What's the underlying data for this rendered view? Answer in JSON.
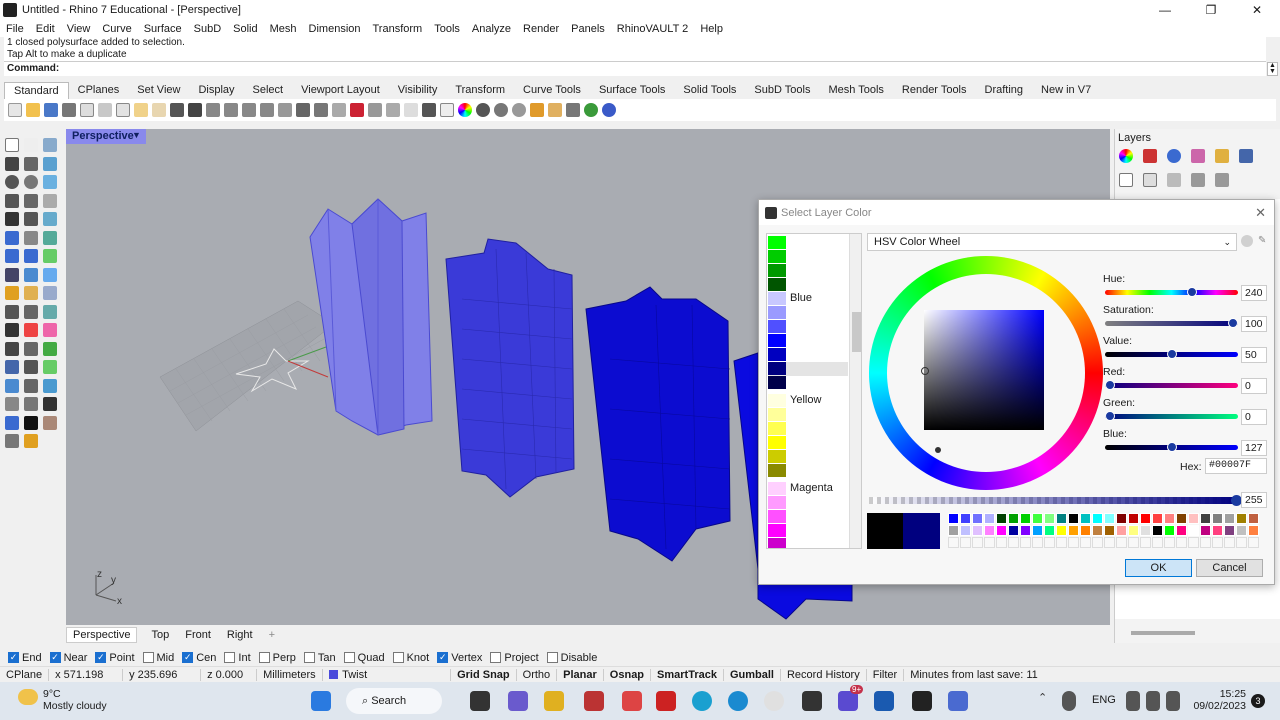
{
  "window": {
    "title": "Untitled - Rhino 7 Educational - [Perspective]",
    "controls": [
      "—",
      "❐",
      "✕"
    ]
  },
  "menu": [
    "File",
    "Edit",
    "View",
    "Curve",
    "Surface",
    "SubD",
    "Solid",
    "Mesh",
    "Dimension",
    "Transform",
    "Tools",
    "Analyze",
    "Render",
    "Panels",
    "RhinoVAULT 2",
    "Help"
  ],
  "command": {
    "history": [
      "1 closed polysurface added to selection.",
      "Tap Alt to make a duplicate"
    ],
    "prompt": "Command:"
  },
  "tabs": [
    "Standard",
    "CPlanes",
    "Set View",
    "Display",
    "Select",
    "Viewport Layout",
    "Visibility",
    "Transform",
    "Curve Tools",
    "Surface Tools",
    "Solid Tools",
    "SubD Tools",
    "Mesh Tools",
    "Render Tools",
    "Drafting",
    "New in V7"
  ],
  "viewport": {
    "title": "Perspective",
    "axes": {
      "x": "x",
      "y": "y",
      "z": "z"
    },
    "tabs": [
      "Perspective",
      "Top",
      "Front",
      "Right"
    ],
    "add_tab": "+"
  },
  "layers_panel": {
    "title": "Layers"
  },
  "dialog": {
    "title": "Select Layer Color",
    "close": "✕",
    "mode": "HSV Color Wheel",
    "swatch_labels": {
      "blue": "Blue",
      "yellow": "Yellow",
      "magenta": "Magenta"
    },
    "sliders": [
      {
        "label": "Hue:",
        "value": "240",
        "fraction": 0.67
      },
      {
        "label": "Saturation:",
        "value": "100",
        "fraction": 1.0
      },
      {
        "label": "Value:",
        "value": "50",
        "fraction": 0.5
      },
      {
        "label": "Red:",
        "value": "0",
        "fraction": 0.0
      },
      {
        "label": "Green:",
        "value": "0",
        "fraction": 0.0
      },
      {
        "label": "Blue:",
        "value": "127",
        "fraction": 0.5
      }
    ],
    "hex_label": "Hex:",
    "hex_value": "#00007F",
    "alpha_value": "255",
    "ok": "OK",
    "cancel": "Cancel",
    "colors": {
      "old": "#000000",
      "new": "#00007f"
    }
  },
  "osnaps": [
    {
      "label": "End",
      "checked": true
    },
    {
      "label": "Near",
      "checked": true
    },
    {
      "label": "Point",
      "checked": true
    },
    {
      "label": "Mid",
      "checked": false
    },
    {
      "label": "Cen",
      "checked": true
    },
    {
      "label": "Int",
      "checked": false
    },
    {
      "label": "Perp",
      "checked": false
    },
    {
      "label": "Tan",
      "checked": false
    },
    {
      "label": "Quad",
      "checked": false
    },
    {
      "label": "Knot",
      "checked": false
    },
    {
      "label": "Vertex",
      "checked": true
    },
    {
      "label": "Project",
      "checked": false
    },
    {
      "label": "Disable",
      "checked": false
    }
  ],
  "status": {
    "cplane": "CPlane",
    "x": "x 571.198",
    "y": "y 235.696",
    "z": "z 0.000",
    "units": "Millimeters",
    "layer": "Twist",
    "grid_snap": "Grid Snap",
    "ortho": "Ortho",
    "planar": "Planar",
    "osnap": "Osnap",
    "smarttrack": "SmartTrack",
    "gumball": "Gumball",
    "record_history": "Record History",
    "filter": "Filter",
    "last_save": "Minutes from last save: 11"
  },
  "taskbar": {
    "temperature": "9°C",
    "weather": "Mostly cloudy",
    "search": "Search",
    "language": "ENG",
    "time": "15:25",
    "date": "09/02/2023",
    "notifications": "3",
    "badge": "9+"
  }
}
